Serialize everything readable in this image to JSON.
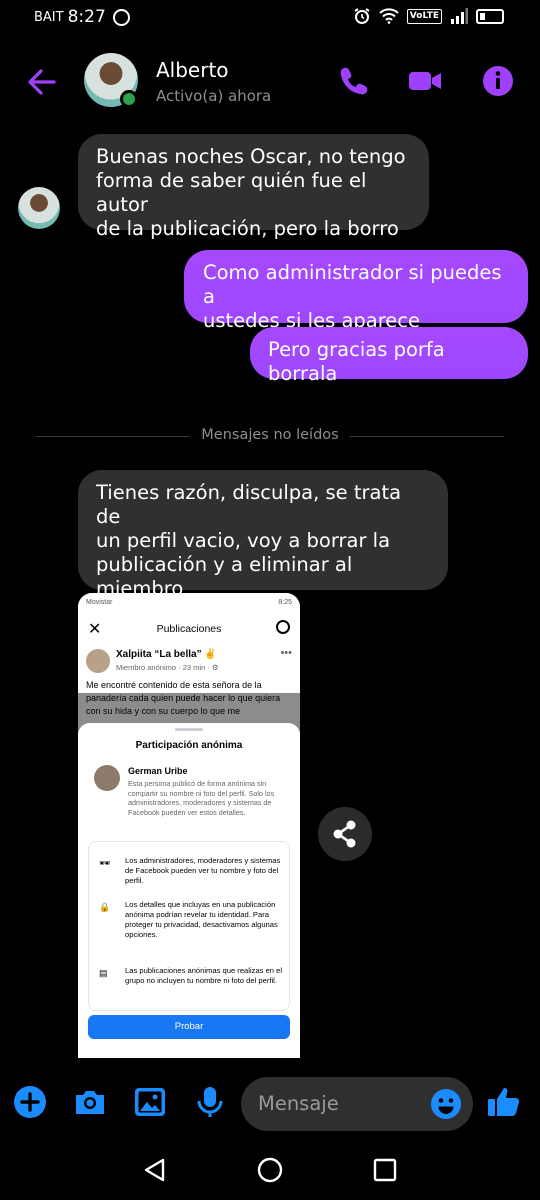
{
  "status_bar": {
    "carrier": "BAIT",
    "time": "8:27",
    "volte": "VoLTE"
  },
  "header": {
    "contact_name": "Alberto",
    "presence": "Activo(a) ahora",
    "icons": [
      "back-arrow-icon",
      "phone-icon",
      "video-camera-icon",
      "info-icon"
    ],
    "accent_color": "#a040ff"
  },
  "messages": [
    {
      "direction": "in",
      "text": "Buenas noches Oscar, no tengo\nforma de saber quién fue el autor\nde la publicación, pero la borro"
    },
    {
      "direction": "out",
      "text": "Como administrador si puedes a\nustedes si les aparece"
    },
    {
      "direction": "out",
      "text": "Pero gracias porfa borrala"
    },
    {
      "direction": "in",
      "text": "Tienes razón, disculpa, se trata de\nun perfil vacio, voy a borrar la\npublicación y a eliminar al miembro\ndel grupo"
    }
  ],
  "divider": {
    "label": "Mensajes no leídos"
  },
  "shared_image": {
    "status_left": "Movistar",
    "status_right": "8:25",
    "title": "Publicaciones",
    "post_author": "Xalpiita “La bella” ✌",
    "post_meta": "Miembro anónimo · 23 min · ⚙",
    "post_text": "Me encontré contenido de esta señora de la panadería cada quien puede hacer lo que quiera con  su hida y con su cuerpo lo que me",
    "sheet_title": "Participación anónima",
    "person_name": "German Uribe",
    "person_desc": "Esta persona publicó de forma anónima sin compartir su nombre ni foto del perfil. Solo los administradores, moderadores y sistemas de Facebook pueden ver estos detalles.",
    "info_rows": [
      {
        "icon": "incognito-icon",
        "text": "Los administradores, moderadores y sistemas de Facebook pueden ver tu nombre y foto del perfil."
      },
      {
        "icon": "lock-icon",
        "text": "Los detalles que incluyas en una publicación anónima podrían revelar tu identidad. Para proteger tu privacidad, desactivamos algunas opciones."
      },
      {
        "icon": "post-icon",
        "text": "Las publicaciones anónimas que realizas en el grupo no incluyen tu nombre ni foto del perfil."
      }
    ],
    "button_label": "Probar"
  },
  "composer": {
    "placeholder": "Mensaje",
    "icons": [
      "plus-icon",
      "camera-icon",
      "gallery-icon",
      "microphone-icon",
      "emoji-icon",
      "like-icon"
    ],
    "icon_color": "#1a8cff"
  },
  "nav_bar": {
    "icons": [
      "back-icon",
      "home-icon",
      "recents-icon"
    ]
  }
}
